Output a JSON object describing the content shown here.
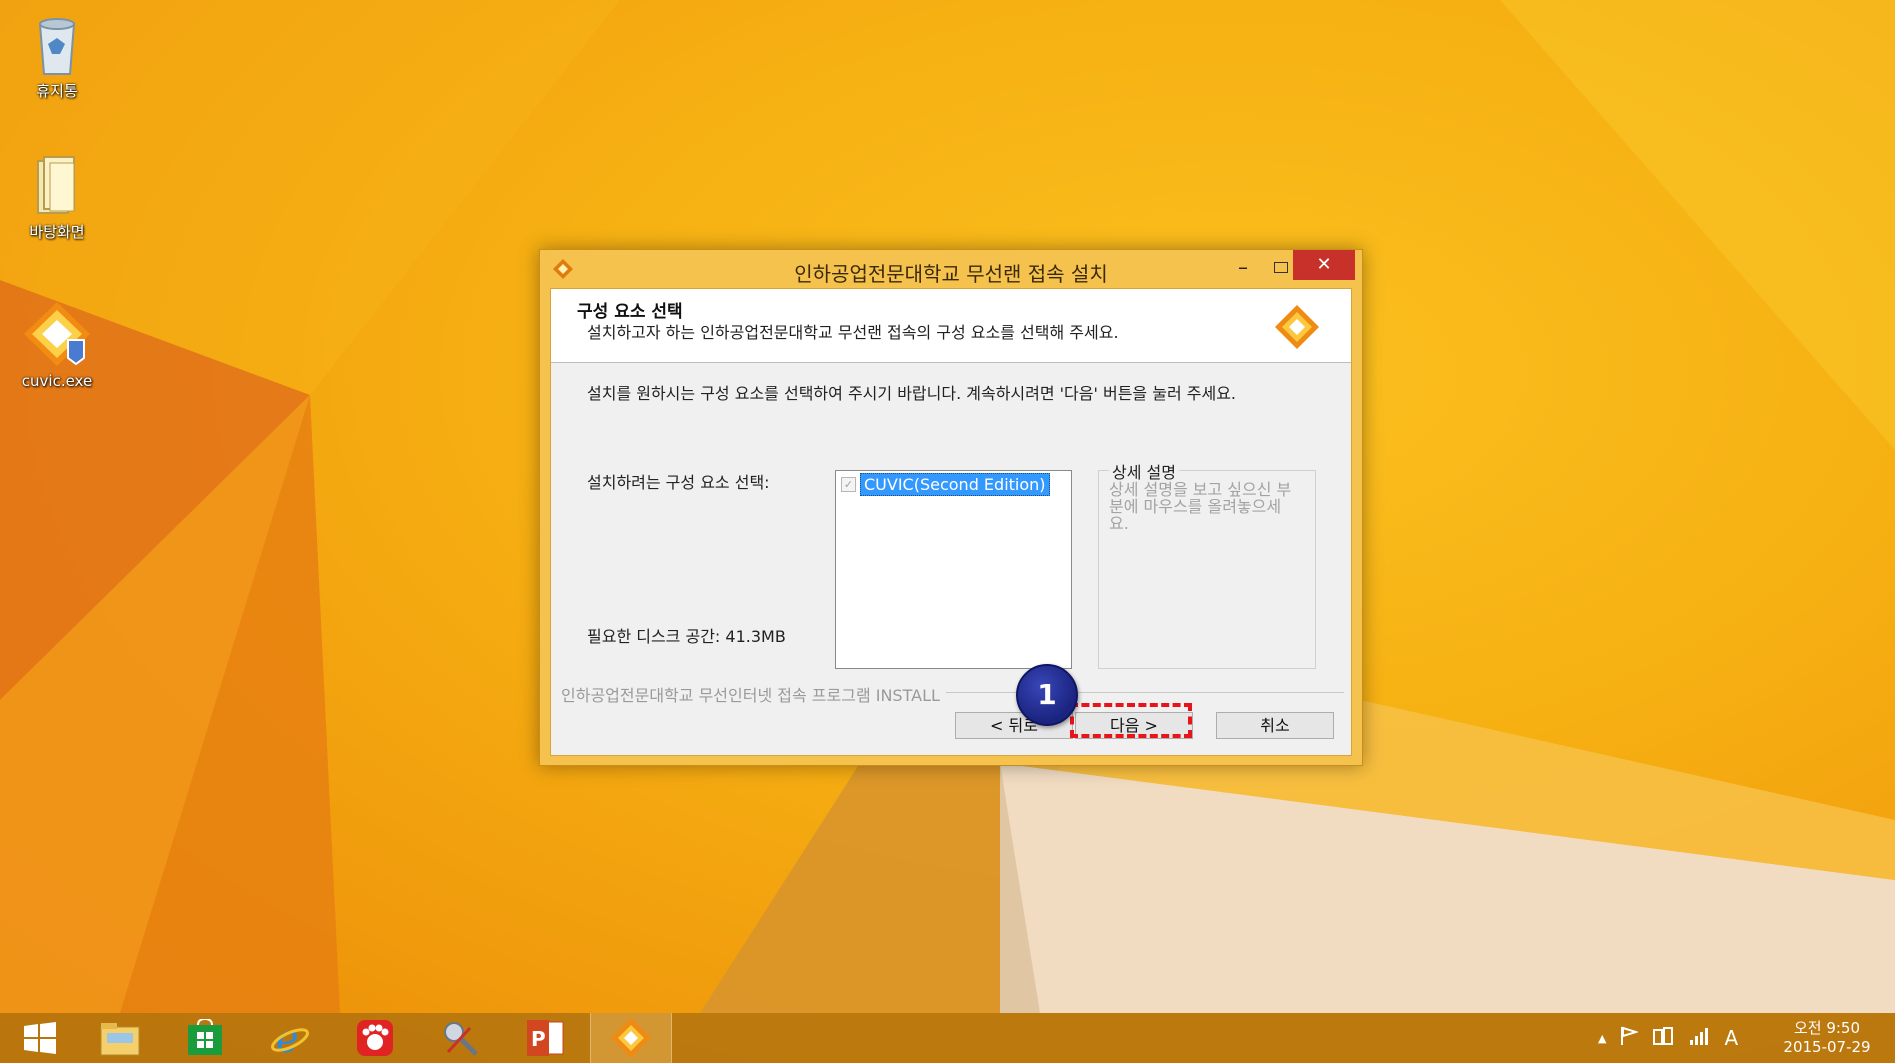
{
  "desktop": {
    "icons": [
      {
        "label": "휴지통",
        "icon": "recycle-bin-icon"
      },
      {
        "label": "바탕화면",
        "icon": "folder-icon"
      },
      {
        "label": "cuvic.exe",
        "icon": "installer-icon"
      }
    ]
  },
  "dialog": {
    "title": "인하공업전문대학교 무선랜 접속 설치",
    "close_glyph": "✕",
    "min_glyph": "–",
    "header": {
      "title": "구성 요소 선택",
      "subtitle": "설치하고자 하는 인하공업전문대학교 무선랜 접속의 구성 요소를 선택해 주세요."
    },
    "instructions": "설치를 원하시는 구성 요소를 선택하여 주시기 바랍니다. 계속하시려면 '다음' 버튼을 눌러 주세요.",
    "select_label": "설치하려는 구성 요소 선택:",
    "components": [
      {
        "label": "CUVIC(Second Edition)",
        "checked": true,
        "selected": true
      }
    ],
    "check_glyph": "✓",
    "description": {
      "title": "상세 설명",
      "text": "상세 설명을 보고 싶으신 부분에 마우스를 올려놓으세요."
    },
    "disk_space": "필요한 디스크 공간: 41.3MB",
    "brand_text": "인하공업전문대학교 무선인터넷 접속 프로그램 INSTALL",
    "buttons": {
      "back": "< 뒤로",
      "next": "다음 >",
      "cancel": "취소"
    }
  },
  "annotation": {
    "step_number": "1",
    "highlight_color": "#e8141b"
  },
  "taskbar": {
    "apps": [
      "start-icon",
      "file-explorer-icon",
      "store-icon",
      "internet-explorer-icon",
      "paw-app-icon",
      "tools-app-icon",
      "powerpoint-icon",
      "installer-icon"
    ],
    "tray": {
      "chevron": "▲",
      "ime": "A"
    },
    "clock": {
      "time": "오전 9:50",
      "date": "2015-07-29"
    }
  },
  "colors": {
    "wallpaper": "#f6b012",
    "dialog_frame": "#f5c24d",
    "close_button": "#c7312a",
    "selection": "#3399ff",
    "badge": "#1a237e"
  }
}
